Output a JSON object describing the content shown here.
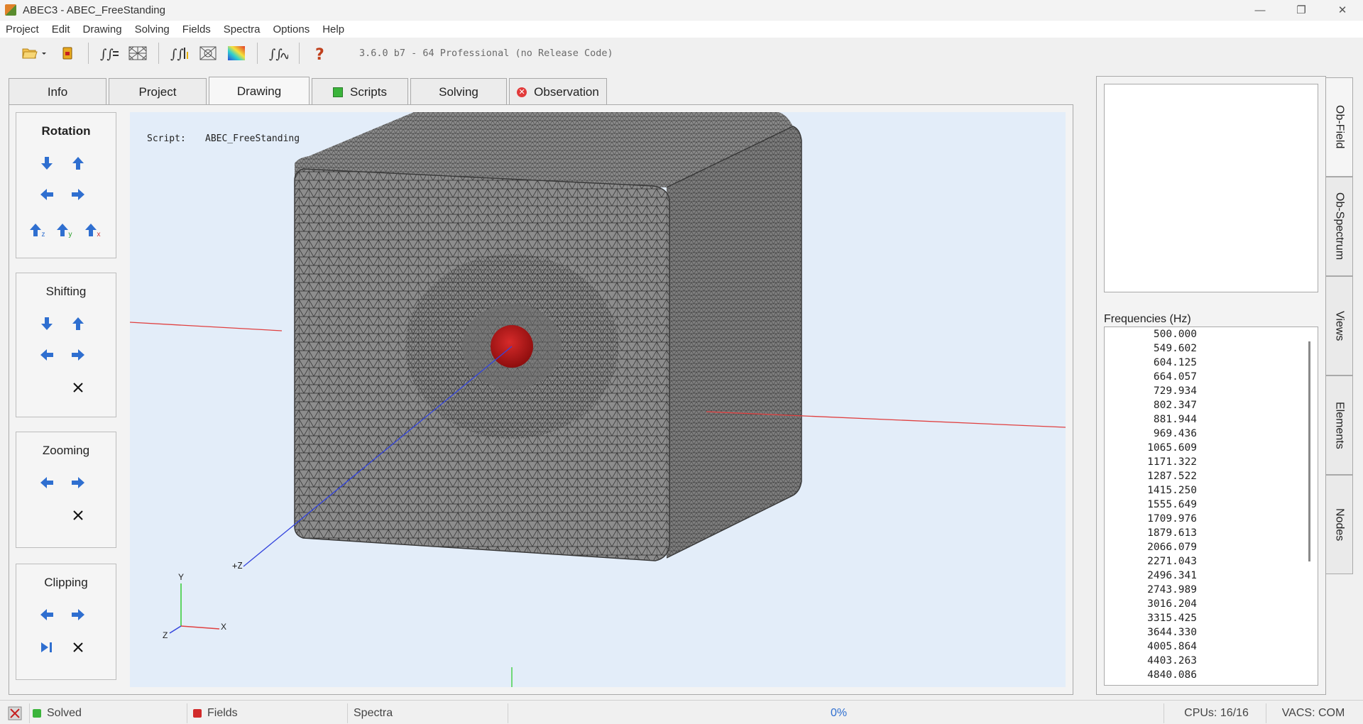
{
  "window": {
    "title": "ABEC3 - ABEC_FreeStanding",
    "minimize": "—",
    "maximize": "❐",
    "close": "✕"
  },
  "menu": [
    "Project",
    "Edit",
    "Drawing",
    "Solving",
    "Fields",
    "Spectra",
    "Options",
    "Help"
  ],
  "toolbar": {
    "version": "3.6.0 b7 - 64 Professional (no Release Code)"
  },
  "tabs": {
    "info": "Info",
    "project": "Project",
    "drawing": "Drawing",
    "scripts": "Scripts",
    "solving": "Solving",
    "observation": "Observation"
  },
  "controls": {
    "rotation": "Rotation",
    "shifting": "Shifting",
    "zooming": "Zooming",
    "clipping": "Clipping",
    "axis_z": "z",
    "axis_y": "y",
    "axis_x": "x"
  },
  "viewport": {
    "script_label": "Script:",
    "script_name": "ABEC_FreeStanding",
    "axis_z_label": "+Z",
    "triad_y": "Y",
    "triad_x": "X",
    "triad_z": "Z",
    "colors": {
      "background": "#e3edf9",
      "mesh": "#8d8d8d",
      "source": "#b01616",
      "x_axis": "#e04040",
      "y_axis": "#33cc33",
      "z_axis": "#3344dd"
    }
  },
  "right_panel": {
    "frequencies_label": "Frequencies  (Hz)",
    "frequencies": [
      "500.000",
      "549.602",
      "604.125",
      "664.057",
      "729.934",
      "802.347",
      "881.944",
      "969.436",
      "1065.609",
      "1171.322",
      "1287.522",
      "1415.250",
      "1555.649",
      "1709.976",
      "1879.613",
      "2066.079",
      "2271.043",
      "2496.341",
      "2743.989",
      "3016.204",
      "3315.425",
      "3644.330",
      "4005.864",
      "4403.263",
      "4840.086"
    ]
  },
  "side_tabs": [
    "Ob-Field",
    "Ob-Spectrum",
    "Views",
    "Elements",
    "Nodes"
  ],
  "status": {
    "solved": "Solved",
    "fields": "Fields",
    "spectra": "Spectra",
    "progress": "0%",
    "cpus": "CPUs: 16/16",
    "vacs": "VACS: COM"
  }
}
